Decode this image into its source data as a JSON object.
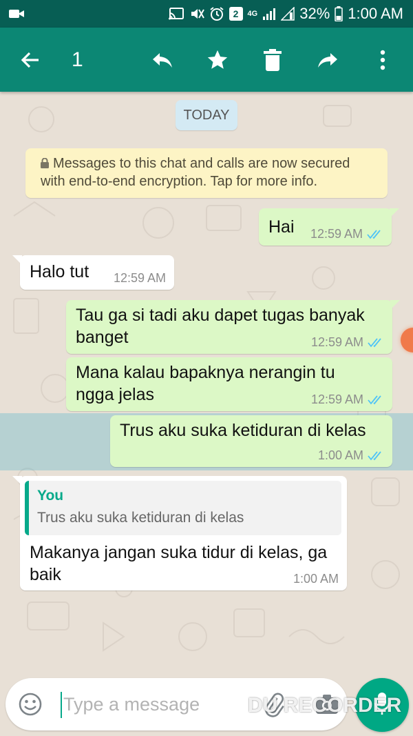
{
  "status_bar": {
    "battery": "32%",
    "time": "1:00 AM",
    "network": "4G",
    "notification_count": "2"
  },
  "action_bar": {
    "selected_count": "1",
    "icons": [
      "back-arrow-icon",
      "reply-icon",
      "star-icon",
      "delete-icon",
      "forward-icon",
      "more-vert-icon"
    ]
  },
  "chat": {
    "date_chip": "TODAY",
    "encryption_notice": "Messages to this chat and calls are now secured with end-to-end encryption. Tap for more info.",
    "messages": [
      {
        "direction": "outgoing",
        "text": "Hai",
        "time": "12:59 AM",
        "status": "read"
      },
      {
        "direction": "incoming",
        "text": "Halo tut",
        "time": "12:59 AM"
      },
      {
        "direction": "outgoing",
        "text": "Tau ga si tadi aku dapet tugas banyak banget",
        "time": "12:59 AM",
        "status": "read"
      },
      {
        "direction": "outgoing",
        "text": "Mana kalau bapaknya nerangin tu ngga jelas",
        "time": "12:59 AM",
        "status": "read"
      },
      {
        "direction": "outgoing",
        "text": "Trus aku suka ketiduran di kelas",
        "time": "1:00 AM",
        "status": "read",
        "selected": true
      },
      {
        "direction": "incoming",
        "quote_author": "You",
        "quote_text": "Trus aku suka ketiduran di kelas",
        "text": "Makanya jangan suka tidur di kelas, ga baik",
        "time": "1:00 AM"
      }
    ]
  },
  "input": {
    "placeholder": "Type a message"
  },
  "watermark": "DU RECORDER",
  "colors": {
    "header": "#0c8774",
    "status_bar": "#075e54",
    "outgoing_bubble": "#dcf8c6",
    "incoming_bubble": "#ffffff",
    "accent": "#00a884",
    "read_ticks": "#4fc3f7"
  }
}
